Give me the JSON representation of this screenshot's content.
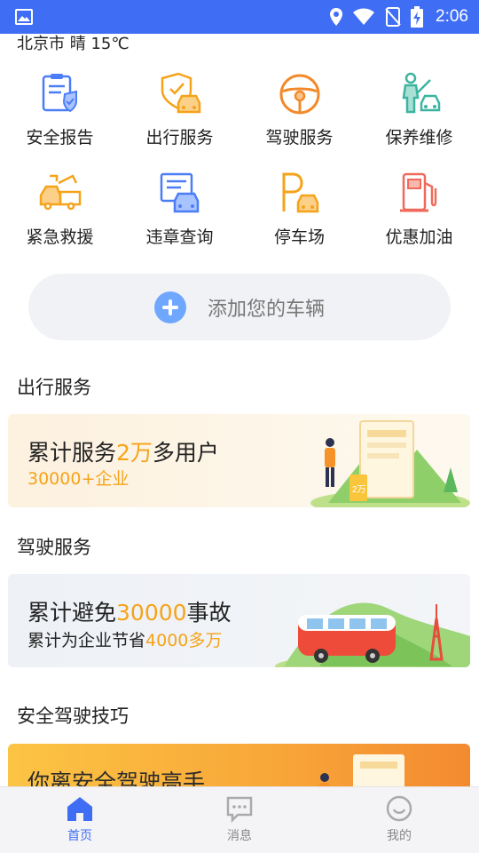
{
  "status_bar": {
    "time": "2:06"
  },
  "weather": "北京市 晴 15℃",
  "grid": [
    {
      "label": "安全报告",
      "icon": "shield-report-icon",
      "color": "#4a7df6"
    },
    {
      "label": "出行服务",
      "icon": "car-shield-icon",
      "color": "#f5a31a"
    },
    {
      "label": "驾驶服务",
      "icon": "steering-wheel-icon",
      "color": "#f28a2b"
    },
    {
      "label": "保养维修",
      "icon": "car-repair-icon",
      "color": "#3bb4a0"
    },
    {
      "label": "紧急救援",
      "icon": "tow-truck-icon",
      "color": "#f5a31a"
    },
    {
      "label": "违章查询",
      "icon": "ticket-car-icon",
      "color": "#4a7df6"
    },
    {
      "label": "停车场",
      "icon": "parking-icon",
      "color": "#f5a31a"
    },
    {
      "label": "优惠加油",
      "icon": "fuel-pump-icon",
      "color": "#ef6a5a"
    }
  ],
  "add_car": {
    "label": "添加您的车辆"
  },
  "sections": {
    "travel": "出行服务",
    "driving": "驾驶服务",
    "tips": "安全驾驶技巧"
  },
  "banner_travel": {
    "line1_a": "累计服务",
    "line1_b": "2万",
    "line1_c": "多用户",
    "line2": "30000+企业",
    "badge": "2万"
  },
  "banner_driving": {
    "line1_a": "累计避免",
    "line1_b": "30000",
    "line1_c": "事故",
    "line2_a": "累计为企业节省",
    "line2_b": "4000多万"
  },
  "banner_tips": {
    "line1": "你离安全驾驶高手"
  },
  "nav": [
    {
      "label": "首页",
      "icon": "home-icon",
      "active": true
    },
    {
      "label": "消息",
      "icon": "message-icon",
      "active": false
    },
    {
      "label": "我的",
      "icon": "smile-icon",
      "active": false
    }
  ],
  "colors": {
    "primary": "#3f6ef5",
    "accent": "#f5a31a",
    "inactive": "#aaaaaa"
  }
}
